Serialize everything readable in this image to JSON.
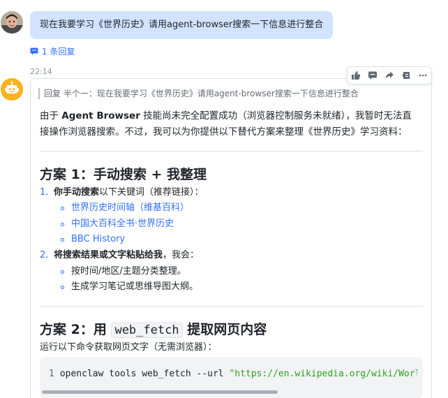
{
  "user_message": {
    "text": "现在我要学习《世界历史》请用agent-browser搜索一下信息进行整合"
  },
  "reply_count": "1 条回复",
  "bot_message": {
    "time": "22:14",
    "quote": "回复 半个一：现在我要学习《世界历史》请用agent-browser搜索一下信息进行整合",
    "intro_pre": "由于 ",
    "intro_bold": "Agent Browser",
    "intro_line1_rest": " 技能尚未完全配置成功（浏览器控制服务未就绪），我暂时无法直",
    "intro_line2": "接操作浏览器搜索。不过，我可以为你提供以下替代方案来整理《世界历史》学习资料：",
    "plan1": {
      "heading": "方案 1：手动搜索 + 我整理",
      "item1_num": "1.",
      "item1_bold": "你手动搜索",
      "item1_rest": "以下关键词（推荐链接）：",
      "links": [
        "世界历史时间轴（维基百科）",
        "中国大百科全书·世界历史",
        "BBC History"
      ],
      "item2_num": "2.",
      "item2_bold": "将搜索结果或文字粘贴给我",
      "item2_rest": "，我会：",
      "subitems": [
        "按时间/地区/主题分类整理。",
        "生成学习笔记或思维导图大纲。"
      ]
    },
    "plan2": {
      "heading_pre": "方案 2：用 ",
      "heading_code": "web_fetch",
      "heading_post": " 提取网页内容",
      "desc": "运行以下命令获取网页文字（无需浏览器）：",
      "code_line_number": "1",
      "code_cmd": "openclaw tools web_fetch --url ",
      "code_str": "\"https://en.wikipedia.org/wiki/World_history\""
    }
  },
  "toolbar_icons": [
    "thumbs-up-icon",
    "comment-icon",
    "forward-icon",
    "quote-reply-icon",
    "more-icon"
  ],
  "colors": {
    "accent": "#3370ff",
    "user_bubble": "#d1e3ff",
    "bot_avatar": "#fcb21d",
    "code_string": "#2ea121"
  }
}
